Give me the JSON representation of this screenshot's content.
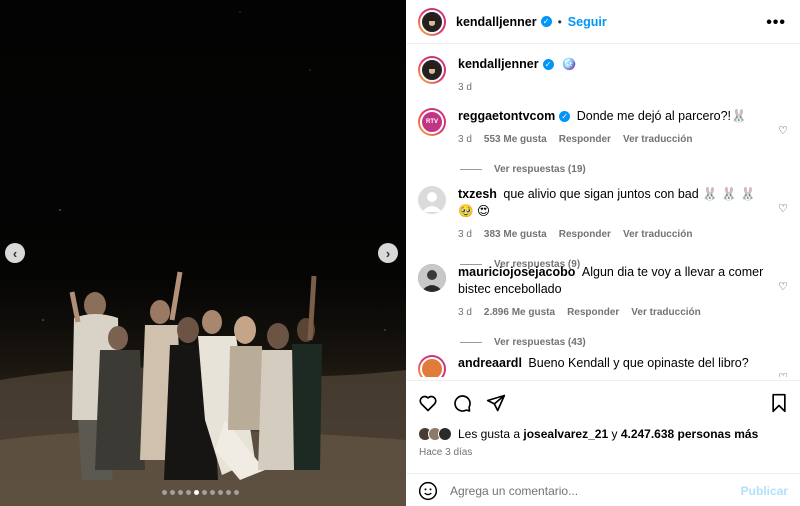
{
  "post": {
    "author": "kendalljenner",
    "follow_label": "Seguir",
    "separator": "•",
    "more_label": "•••",
    "caption_emoji": "🪩",
    "caption_time": "3 d"
  },
  "media": {
    "prev_label": "‹",
    "next_label": "›",
    "dot_count": 10,
    "active_dot": 4
  },
  "comments": [
    {
      "user": "reggaetontvcom",
      "verified": true,
      "text": "Donde me dejó al parcero?!🐰",
      "time": "3 d",
      "likes": "553 Me gusta",
      "reply": "Responder",
      "translate": "Ver traducción",
      "replies": "Ver respuestas (19)",
      "avatar_color": "#c13584"
    },
    {
      "user": "txzesh",
      "verified": false,
      "text": "que alivio que sigan juntos con bad 🐰 🐰 🐰 🥹 😍",
      "time": "3 d",
      "likes": "383 Me gusta",
      "reply": "Responder",
      "translate": "Ver traducción",
      "replies": "Ver respuestas (9)",
      "avatar_color": "#dbdbdb"
    },
    {
      "user": "mauriciojosejacobo",
      "verified": false,
      "text": "Algun dia te voy a llevar a comer bistec encebollado",
      "time": "3 d",
      "likes": "2.896 Me gusta",
      "reply": "Responder",
      "translate": "Ver traducción",
      "replies": "Ver respuestas (43)",
      "avatar_color": "#6b6b6b"
    },
    {
      "user": "andreaardl",
      "verified": false,
      "text": "Bueno Kendall y que opinaste del libro?",
      "avatar_color": "#e07b39"
    }
  ],
  "likes": {
    "prefix": "Les gusta a",
    "user": "josealvarez_21",
    "middle": "y",
    "count": "4.247.638 personas más",
    "ago": "Hace 3 días"
  },
  "composer": {
    "placeholder": "Agrega un comentario...",
    "publish": "Publicar"
  },
  "colors": {
    "accent": "#0095f6",
    "muted": "#737373"
  }
}
